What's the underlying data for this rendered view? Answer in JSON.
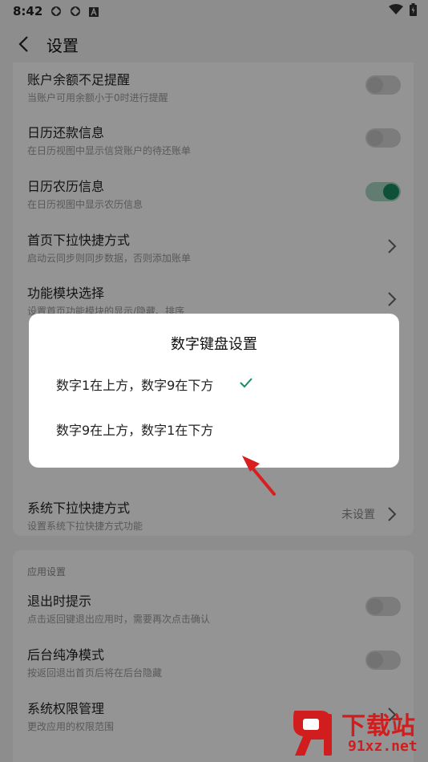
{
  "status_bar": {
    "time": "8:42",
    "icons": [
      "app-icon-1",
      "app-icon-2",
      "a-icon",
      "wifi-icon",
      "battery-icon"
    ]
  },
  "app_bar": {
    "title": "设置",
    "back_icon": "chevron-left-icon"
  },
  "card1": {
    "rows": [
      {
        "title": "账户余额不足提醒",
        "subtitle": "当账户可用余额小于0时进行提醒",
        "control": "toggle",
        "on": false
      },
      {
        "title": "日历还款信息",
        "subtitle": "在日历视图中显示信贷账户的待还账单",
        "control": "toggle",
        "on": false
      },
      {
        "title": "日历农历信息",
        "subtitle": "在日历视图中显示农历信息",
        "control": "toggle",
        "on": true
      },
      {
        "title": "首页下拉快捷方式",
        "subtitle": "启动云同步则同步数据，否则添加账单",
        "control": "chevron"
      },
      {
        "title": "功能模块选择",
        "subtitle": "设置首页功能模块的显示/隐藏、排序",
        "control": "chevron"
      },
      {
        "title": "系统下拉快捷方式",
        "subtitle": "设置系统下拉快捷方式功能",
        "control": "chevron",
        "value": "未设置"
      }
    ]
  },
  "card2": {
    "section_label": "应用设置",
    "rows": [
      {
        "title": "退出时提示",
        "subtitle": "点击返回键退出应用时，需要再次点击确认",
        "control": "toggle",
        "on": false
      },
      {
        "title": "后台纯净模式",
        "subtitle": "按返回退出首页后将在后台隐藏",
        "control": "toggle",
        "on": false
      },
      {
        "title": "系统权限管理",
        "subtitle": "更改应用的权限范围",
        "control": "chevron"
      }
    ]
  },
  "dialog": {
    "title": "数字键盘设置",
    "options": [
      {
        "label": "数字1在上方，数字9在下方",
        "selected": true
      },
      {
        "label": "数字9在上方，数字1在下方",
        "selected": false
      }
    ]
  },
  "colors": {
    "accent": "#1b8a63",
    "annotation_arrow": "#d81e1e",
    "watermark": "#d11d1d"
  },
  "watermark": {
    "name": "下载站",
    "domain": "91xz.net"
  }
}
